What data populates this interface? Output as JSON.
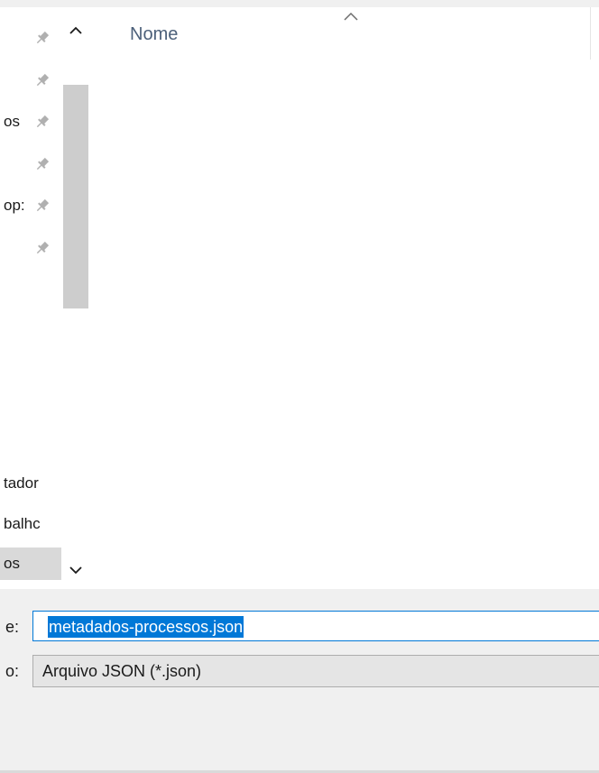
{
  "nav_pane": {
    "items": [
      {
        "label": "",
        "pinned": true
      },
      {
        "label": "",
        "pinned": true
      },
      {
        "label": "os",
        "pinned": true
      },
      {
        "label": "",
        "pinned": true
      },
      {
        "label": "op:",
        "pinned": true
      },
      {
        "label": "",
        "pinned": true
      },
      {
        "label": "tador",
        "pinned": false
      },
      {
        "label": "balhc",
        "pinned": false
      },
      {
        "label": "os",
        "pinned": false,
        "selected": true
      }
    ]
  },
  "file_list": {
    "column_header": "Nome",
    "sort_indicator": "chevron-up-icon"
  },
  "form": {
    "filename_label": "e:",
    "filename_value": "metadados-processos.json",
    "filetype_label": "o:",
    "filetype_value": "Arquivo JSON (*.json)"
  },
  "colors": {
    "accent": "#0078d7",
    "pin": "#b0b0b0",
    "header_text": "#4c607a",
    "scroll_thumb": "#cdcdcd"
  }
}
